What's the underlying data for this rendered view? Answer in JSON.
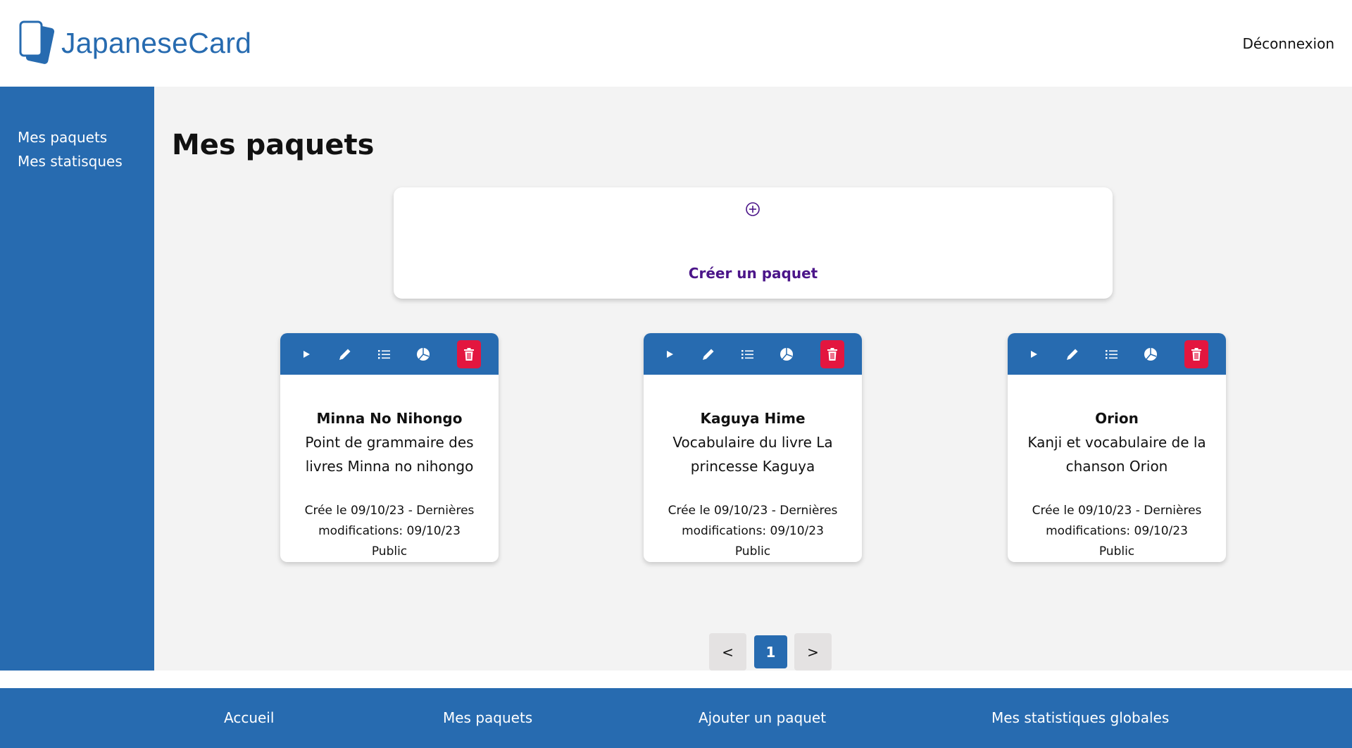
{
  "header": {
    "logo_text": "JapaneseCard",
    "logout_label": "Déconnexion",
    "brand_color": "#276BB0"
  },
  "sidebar": {
    "items": [
      {
        "label": "Mes paquets"
      },
      {
        "label": "Mes statisques"
      }
    ]
  },
  "main": {
    "title": "Mes paquets",
    "create_card": {
      "icon": "plus-circle-icon",
      "label": "Créer un paquet"
    },
    "decks": [
      {
        "title": "Minna No Nihongo",
        "description": "Point de grammaire des livres Minna no nihongo",
        "meta": "Crée le 09/10/23 - Dernières modifications: 09/10/23",
        "visibility": "Public"
      },
      {
        "title": "Kaguya Hime",
        "description": "Vocabulaire du livre La princesse Kaguya",
        "meta": "Crée le 09/10/23 - Dernières modifications: 09/10/23",
        "visibility": "Public"
      },
      {
        "title": "Orion",
        "description": "Kanji et vocabulaire de la chanson Orion",
        "meta": "Crée le 09/10/23 - Dernières modifications: 09/10/23",
        "visibility": "Public"
      }
    ],
    "deck_toolbar_icons": [
      "play-icon",
      "pencil-icon",
      "list-icon",
      "pie-chart-icon",
      "trash-icon"
    ],
    "pagination": {
      "prev": "<",
      "current": "1",
      "next": ">"
    }
  },
  "footer": {
    "links": [
      {
        "label": "Accueil"
      },
      {
        "label": "Mes paquets"
      },
      {
        "label": "Ajouter un paquet"
      },
      {
        "label": "Mes statistiques globales"
      }
    ]
  },
  "colors": {
    "primary": "#276BB0",
    "danger": "#E3163F",
    "accent_purple": "#4B1589",
    "background": "#f3f3f3"
  }
}
